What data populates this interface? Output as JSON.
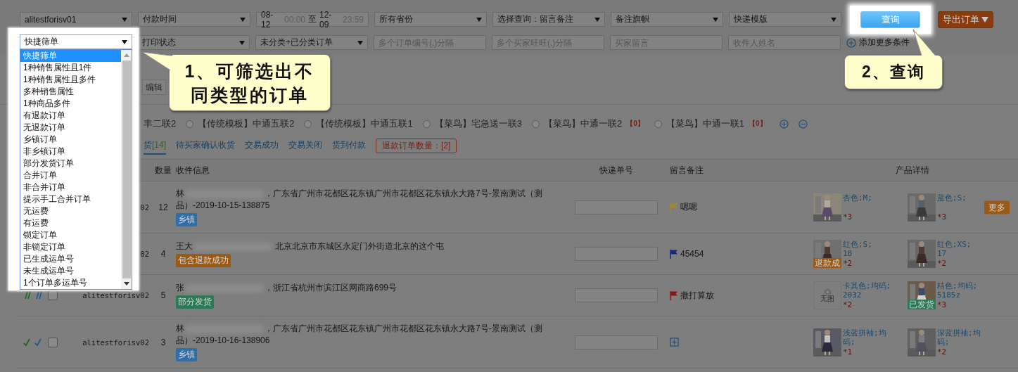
{
  "filters_row1": [
    {
      "kind": "select",
      "value": "alitestforisv01"
    },
    {
      "kind": "select",
      "value": "付款时间"
    },
    {
      "kind": "date_range",
      "start_date": "08-12",
      "start_time": "00:00",
      "separator": "至",
      "end_date": "12-09",
      "end_time": "23:59"
    },
    {
      "kind": "select",
      "value": "所有省份"
    },
    {
      "kind": "select",
      "value": "选择查询：留言备注"
    },
    {
      "kind": "select",
      "value": "备注旗帜"
    },
    {
      "kind": "select",
      "value": "快递模版"
    }
  ],
  "query_button": {
    "label": "查询"
  },
  "export_button": {
    "label": "导出订单"
  },
  "quick_filter": {
    "value": "快捷筛单",
    "expanded": true,
    "options": [
      {
        "label": "快捷筛单",
        "selected": true
      },
      {
        "label": "1种销售属性且1件",
        "selected": false
      },
      {
        "label": "1种销售属性且多件",
        "selected": false
      },
      {
        "label": "多种销售属性",
        "selected": false
      },
      {
        "label": "1种商品多件",
        "selected": false
      },
      {
        "label": "有退款订单",
        "selected": false
      },
      {
        "label": "无退款订单",
        "selected": false
      },
      {
        "label": "乡镇订单",
        "selected": false
      },
      {
        "label": "非乡镇订单",
        "selected": false
      },
      {
        "label": "部分发货订单",
        "selected": false
      },
      {
        "label": "合并订单",
        "selected": false
      },
      {
        "label": "非合并订单",
        "selected": false
      },
      {
        "label": "提示手工合并订单",
        "selected": false
      },
      {
        "label": "无运费",
        "selected": false
      },
      {
        "label": "有运费",
        "selected": false
      },
      {
        "label": "锁定订单",
        "selected": false
      },
      {
        "label": "非锁定订单",
        "selected": false
      },
      {
        "label": "已生成运单号",
        "selected": false
      },
      {
        "label": "未生成运单号",
        "selected": false
      },
      {
        "label": "1个订单多运单号",
        "selected": false
      }
    ]
  },
  "filters_row2": [
    {
      "kind": "select",
      "value": "打印状态"
    },
    {
      "kind": "select",
      "value": "未分类+已分类订单"
    },
    {
      "kind": "input",
      "placeholder": "多个订单编号(,)分隔"
    },
    {
      "kind": "input",
      "placeholder": "多个买家旺旺(,)分隔"
    },
    {
      "kind": "input",
      "placeholder": "买家留言"
    },
    {
      "kind": "input",
      "placeholder": "收件人姓名"
    }
  ],
  "add_conditions": {
    "label": "添加更多条件"
  },
  "edit_button": {
    "label": "编辑"
  },
  "template_cut_label": "丰二联2",
  "templates": [
    {
      "label": "【传统模板】中通五联2",
      "selected": false
    },
    {
      "label": "【传统模板】中通五联1",
      "selected": false
    },
    {
      "label": "【菜鸟】宅急送一联3",
      "selected": false
    },
    {
      "label": "【菜鸟】中通一联2",
      "count": "【0】",
      "selected": false
    },
    {
      "label": "【菜鸟】中通一联1",
      "count": "【0】",
      "selected": false
    }
  ],
  "status_tabs": [
    {
      "label": "货",
      "count": "[14]",
      "selected": true
    },
    {
      "label": "待买家确认收货",
      "selected": false
    },
    {
      "label": "交易成功",
      "selected": false
    },
    {
      "label": "交易关闭",
      "selected": false
    },
    {
      "label": "货到付款",
      "selected": false
    }
  ],
  "refund_button": {
    "label": "退款订单数量：[2]"
  },
  "table": {
    "columns": [
      "数量",
      "收件信息",
      "快递单号",
      "留言备注",
      "产品详情"
    ],
    "rows": [
      {
        "kind": "covered",
        "account": "02",
        "quantity": "12",
        "recipient": "林",
        "address": "，广东省广州市花都区花东镇广州市花都区花东镇永大路7号-景南测试（测品）-2019-10-15-138875",
        "tag": {
          "label": "乡镇",
          "color": "#2f6fa8"
        },
        "note": {
          "kind": "flag",
          "color": "#a08a2a",
          "text": "嗯嗯"
        },
        "products": [
          {
            "kind": "picture",
            "spec": [
              "杏色;M;"
            ],
            "count": "*3"
          },
          {
            "kind": "picture",
            "spec": [
              "蓝色;S;"
            ],
            "count": "*3"
          }
        ],
        "more": "更多"
      },
      {
        "kind": "covered",
        "account": "02",
        "quantity": "4",
        "recipient": "王大",
        "address": " 北京北京市东城区永定门外街道北京的这个屯",
        "tag": {
          "label": "包含退款成功",
          "color": "#9a5a14"
        },
        "note": {
          "kind": "flag",
          "color": "#14287a",
          "text": "45454"
        },
        "products": [
          {
            "kind": "picture",
            "badge": {
              "label": "退款成",
              "color": "#9a5a14"
            },
            "spec": [
              "红色;S;",
              "18"
            ],
            "count": "*2"
          },
          {
            "kind": "picture",
            "spec": [
              "红色;XS;",
              "17"
            ],
            "count": "*2"
          }
        ]
      },
      {
        "kind": "slashes",
        "checked": false,
        "account": "alitestforisv02",
        "quantity": "5",
        "recipient": "张",
        "address": "，浙江省杭州市滨江区网商路699号",
        "tag": {
          "label": "部分发货",
          "color": "#2a7a56"
        },
        "note": {
          "kind": "flag",
          "color": "#8a1414",
          "text": "撒打算放"
        },
        "products": [
          {
            "kind": "empty",
            "placeholder": "无图",
            "spec": [
              "卡其色;均码;",
              "2032"
            ],
            "count": "*2"
          },
          {
            "kind": "picture",
            "badge": {
              "label": "已发货",
              "color": "#2a7a56"
            },
            "spec": [
              "桔色;均码;",
              "5185z"
            ],
            "count": "*3"
          }
        ]
      },
      {
        "kind": "ticks",
        "checked": false,
        "account": "alitestforisv02",
        "quantity": "3",
        "recipient": "林",
        "address": "，广东省广州市花都区花东镇广州市花都区花东镇永大路7号-景南测试（测品）-2019-10-16-138906",
        "tag": {
          "label": "乡镇",
          "color": "#2f6fa8"
        },
        "note": {
          "kind": "add"
        },
        "products": [
          {
            "kind": "picture",
            "spec": [
              "浅蓝拼袖;均",
              "码;"
            ],
            "count": "*1"
          },
          {
            "kind": "picture",
            "spec": [
              "深蓝拼袖;均",
              "码;"
            ],
            "count": "*2"
          }
        ]
      }
    ]
  },
  "callouts": [
    {
      "kind": "filter",
      "text": "1、可筛选出不同类型的订单"
    },
    {
      "kind": "query",
      "text": "2、查询"
    }
  ]
}
